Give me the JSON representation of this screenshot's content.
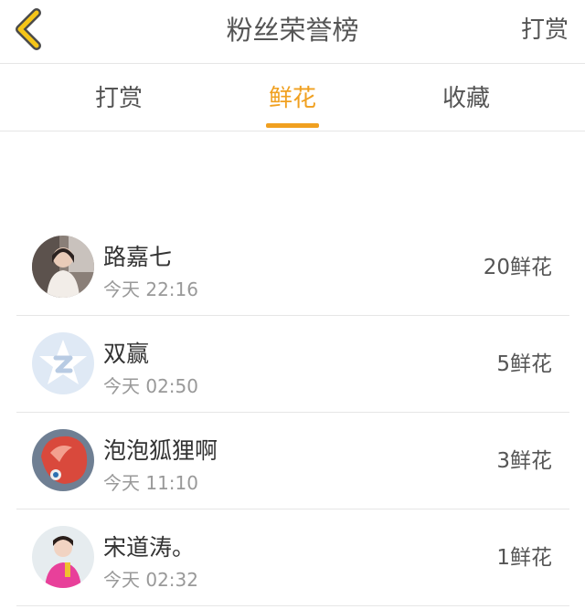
{
  "header": {
    "title": "粉丝荣誉榜",
    "right_action": "打赏",
    "back_icon": "chevron-left-icon",
    "accent_color": "#f5c518"
  },
  "tabs": [
    {
      "label": "打赏",
      "active": false
    },
    {
      "label": "鲜花",
      "active": true
    },
    {
      "label": "收藏",
      "active": false
    }
  ],
  "active_color": "#f0a020",
  "fans": [
    {
      "name": "路嘉七",
      "time": "今天 22:16",
      "count": "20鲜花",
      "avatar": "photo-avatar-woman"
    },
    {
      "name": "双赢",
      "time": "今天 02:50",
      "count": "5鲜花",
      "avatar": "default-star-avatar"
    },
    {
      "name": "泡泡狐狸啊",
      "time": "今天 11:10",
      "count": "3鲜花",
      "avatar": "photo-avatar-fox"
    },
    {
      "name": "宋道涛。",
      "time": "今天 02:32",
      "count": "1鲜花",
      "avatar": "photo-avatar-pink"
    }
  ]
}
